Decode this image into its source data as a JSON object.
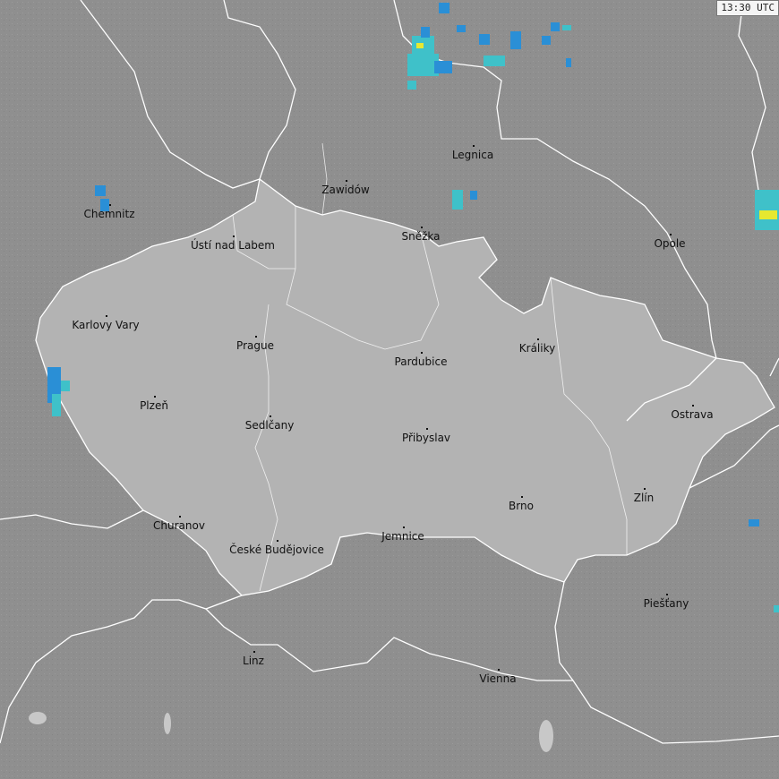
{
  "timestamp": "13:30 UTC",
  "colors": {
    "background": "#8f8f8f",
    "country_fill": "#b3b3b3",
    "border": "#ffffff",
    "lake": "#c8c8c8",
    "radar_light": "#3fc1c9",
    "radar_mid": "#2a8fd6",
    "radar_strong": "#e6e830"
  },
  "cities": [
    {
      "name": "Legnica"
    },
    {
      "name": "Zawidów"
    },
    {
      "name": "Chemnitz"
    },
    {
      "name": "Ústí nad Labem"
    },
    {
      "name": "Sněžka"
    },
    {
      "name": "Opole"
    },
    {
      "name": "Karlovy Vary"
    },
    {
      "name": "Prague"
    },
    {
      "name": "Pardubice"
    },
    {
      "name": "Králiky"
    },
    {
      "name": "Plzeň"
    },
    {
      "name": "Sedlčany"
    },
    {
      "name": "Přibyslav"
    },
    {
      "name": "Ostrava"
    },
    {
      "name": "Zlín"
    },
    {
      "name": "Brno"
    },
    {
      "name": "Churanov"
    },
    {
      "name": "České Budějovice"
    },
    {
      "name": "Jemnice"
    },
    {
      "name": "Piešťany"
    },
    {
      "name": "Linz"
    },
    {
      "name": "Vienna"
    }
  ]
}
